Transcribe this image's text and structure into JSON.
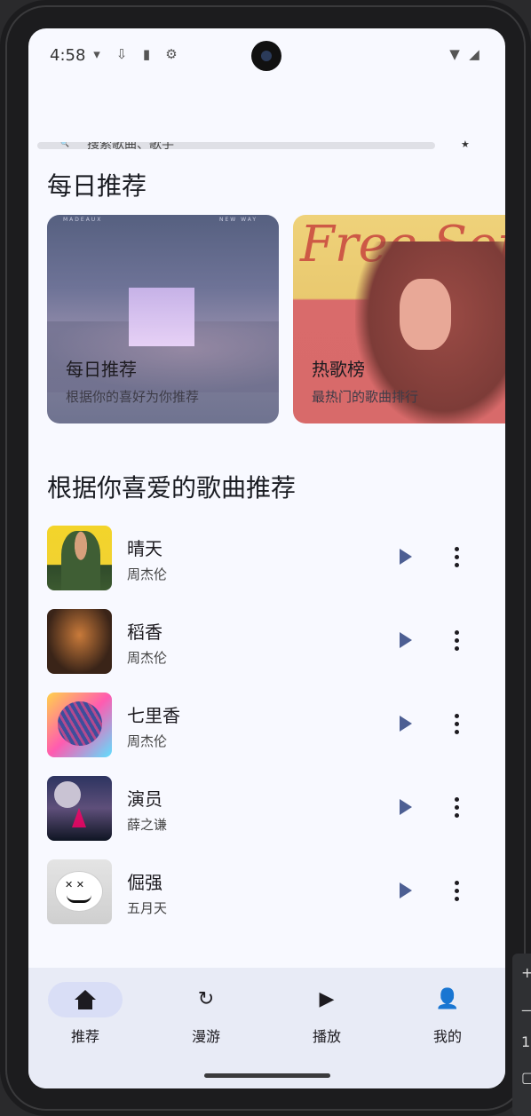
{
  "status_bar": {
    "time": "4:58",
    "left_icons": [
      "wifi-question-icon",
      "download-icon",
      "sd-card-icon",
      "settings-icon"
    ],
    "right_icons": [
      "wifi-alert-icon",
      "signal-icon"
    ]
  },
  "search": {
    "placeholder": "搜索歌曲、歌手"
  },
  "sections": {
    "daily_title": "每日推荐",
    "recommend_title": "根据你喜爱的歌曲推荐"
  },
  "cards": [
    {
      "title": "每日推荐",
      "subtitle": "根据你的喜好为你推荐",
      "cover_text_left": "MADEAUX",
      "cover_text_right": "NEW WAY"
    },
    {
      "title": "热歌榜",
      "subtitle": "最热门的歌曲排行",
      "cover_text": "Free Somebody"
    }
  ],
  "songs": [
    {
      "title": "晴天",
      "artist": "周杰伦"
    },
    {
      "title": "稻香",
      "artist": "周杰伦"
    },
    {
      "title": "七里香",
      "artist": "周杰伦"
    },
    {
      "title": "演员",
      "artist": "薛之谦"
    },
    {
      "title": "倔强",
      "artist": "五月天"
    }
  ],
  "nav": {
    "items": [
      {
        "label": "推荐",
        "icon": "home-icon",
        "active": true
      },
      {
        "label": "漫游",
        "icon": "refresh-icon",
        "active": false
      },
      {
        "label": "播放",
        "icon": "play-icon",
        "active": false
      },
      {
        "label": "我的",
        "icon": "person-icon",
        "active": false
      }
    ]
  },
  "colors": {
    "background": "#f8f9ff",
    "nav_bg": "#e8ebf6",
    "active_pill": "#d9def6",
    "play_button": "#4d5f93"
  }
}
